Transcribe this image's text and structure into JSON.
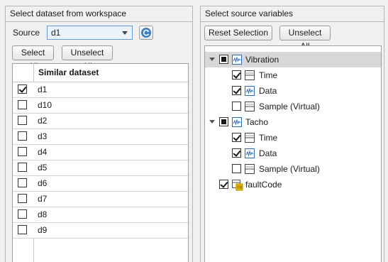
{
  "left": {
    "title": "Select dataset from workspace",
    "source_label": "Source",
    "source_value": "d1",
    "select_all": "Select All",
    "unselect_all": "Unselect All",
    "column_header": "Similar dataset",
    "rows": [
      {
        "name": "d1",
        "checked": true
      },
      {
        "name": "d10",
        "checked": false
      },
      {
        "name": "d2",
        "checked": false
      },
      {
        "name": "d3",
        "checked": false
      },
      {
        "name": "d4",
        "checked": false
      },
      {
        "name": "d5",
        "checked": false
      },
      {
        "name": "d6",
        "checked": false
      },
      {
        "name": "d7",
        "checked": false
      },
      {
        "name": "d8",
        "checked": false
      },
      {
        "name": "d9",
        "checked": false
      }
    ]
  },
  "right": {
    "title": "Select source variables",
    "reset_selection": "Reset Selection",
    "unselect_all": "Unselect All",
    "tree": {
      "vibration": {
        "label": "Vibration",
        "state": "partial",
        "icon": "signal-icon"
      },
      "vibration_time": {
        "label": "Time",
        "state": "checked",
        "icon": "table-column-icon"
      },
      "vibration_data": {
        "label": "Data",
        "state": "checked",
        "icon": "signal-icon"
      },
      "vibration_sample": {
        "label": "Sample (Virtual)",
        "state": "unchecked",
        "icon": "table-column-icon"
      },
      "tacho": {
        "label": "Tacho",
        "state": "partial",
        "icon": "signal-icon"
      },
      "tacho_time": {
        "label": "Time",
        "state": "checked",
        "icon": "table-column-icon"
      },
      "tacho_data": {
        "label": "Data",
        "state": "checked",
        "icon": "signal-icon"
      },
      "tacho_sample": {
        "label": "Sample (Virtual)",
        "state": "unchecked",
        "icon": "table-column-icon"
      },
      "faultcode": {
        "label": "faultCode",
        "state": "checked",
        "icon": "scalar-icon"
      }
    }
  },
  "colors": {
    "dropdown_border": "#6a9bd1",
    "dropdown_bg": "#eaf2fb",
    "signal_icon": "#2a6ebb",
    "scalar_icon": "#d9a400",
    "selected_row": "#d8d8d8"
  }
}
